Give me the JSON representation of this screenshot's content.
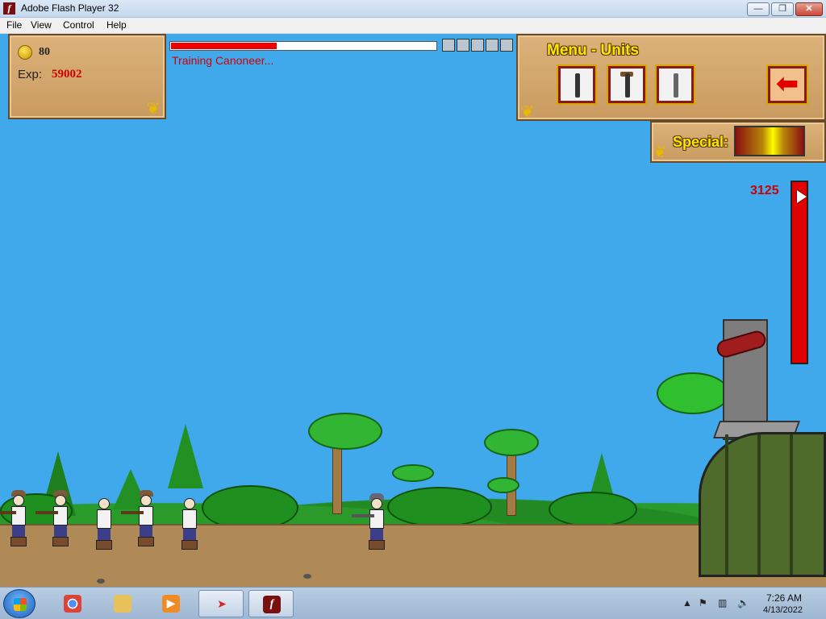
{
  "window": {
    "title": "Adobe Flash Player 32",
    "controls": {
      "minimize": "—",
      "maximize": "❐",
      "close": "✕"
    }
  },
  "menubar": {
    "items": [
      "File",
      "View",
      "Control",
      "Help"
    ]
  },
  "hud": {
    "gold": "80",
    "exp_label": "Exp:",
    "exp_value": "59002",
    "training_status": "Training Canoneer...",
    "training_progress": 0.4,
    "queue_slots": 5,
    "menu_title": "Menu - Units",
    "unit_buttons": [
      "swordsman-unit",
      "musketeer-unit",
      "canoneer-unit"
    ],
    "back_icon": "arrow-left-icon",
    "special_label": "Special:",
    "base_hp": "3125",
    "base_hp_fraction": 1.0
  },
  "colors": {
    "sky": "#3fa9eb",
    "hp_red": "#e00000",
    "menu_yellow": "#ffe600",
    "exp_red": "#c00000"
  },
  "taskbar": {
    "time": "7:26 AM",
    "date": "4/13/2022",
    "pinned": [
      "start-orb-icon",
      "chrome-icon",
      "explorer-icon",
      "media-player-icon",
      "arrow-app-icon",
      "flash-player-icon"
    ]
  }
}
